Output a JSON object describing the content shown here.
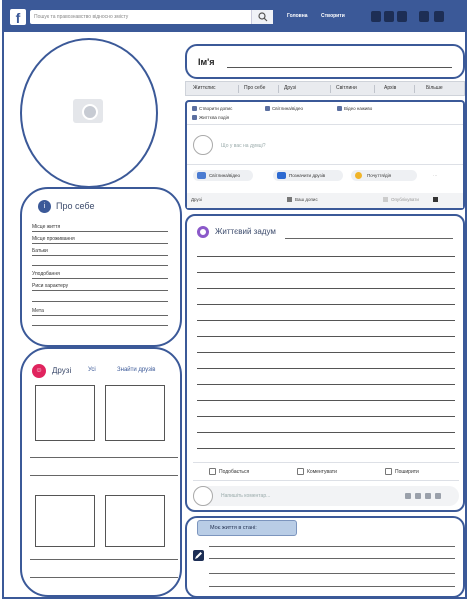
{
  "topbar": {
    "search_placeholder": "Пошук та правознавство відносно змісту",
    "links": [
      "Головна",
      "Створити"
    ],
    "icons": [
      "friends-icon",
      "messages-icon",
      "notifications-icon",
      "help-icon",
      "menu-icon"
    ]
  },
  "profile": {
    "name_label": "Ім'я"
  },
  "tabs": [
    "Життєпис",
    "Про себе",
    "Друзі",
    "Світлини",
    "Архів",
    "Більше"
  ],
  "composer": {
    "tabs": [
      "Створити допис",
      "Світлина/відео",
      "Відео наживо",
      "Життєва подія"
    ],
    "placeholder": "Що у вас на думці?",
    "actions": [
      "Світлина/відео",
      "Позначити друзів",
      "Почуття/дія"
    ],
    "footer": [
      "Друзі",
      "Ваш допис",
      "Опублікувати"
    ]
  },
  "about": {
    "title": "Про себе",
    "rows": [
      "Місце життя",
      "Місце проживання",
      "Батьки",
      "Уподобання",
      "Риси характеру",
      "Мета"
    ]
  },
  "friends": {
    "title": "Друзі",
    "count_label": "Усі",
    "find_link": "Знайти друзів"
  },
  "post": {
    "title": "Життєвий задум",
    "actions": [
      "Подобається",
      "Коментувати",
      "Поширити"
    ],
    "comment_placeholder": "Напишіть коментар..."
  },
  "mood": {
    "tab_label": "Моє життя в стані:"
  },
  "colors": {
    "brand": "#3b5998",
    "friends_accent": "#e0245e",
    "post_accent": "#8b59c9",
    "mood_tab": "#b9cde6"
  }
}
